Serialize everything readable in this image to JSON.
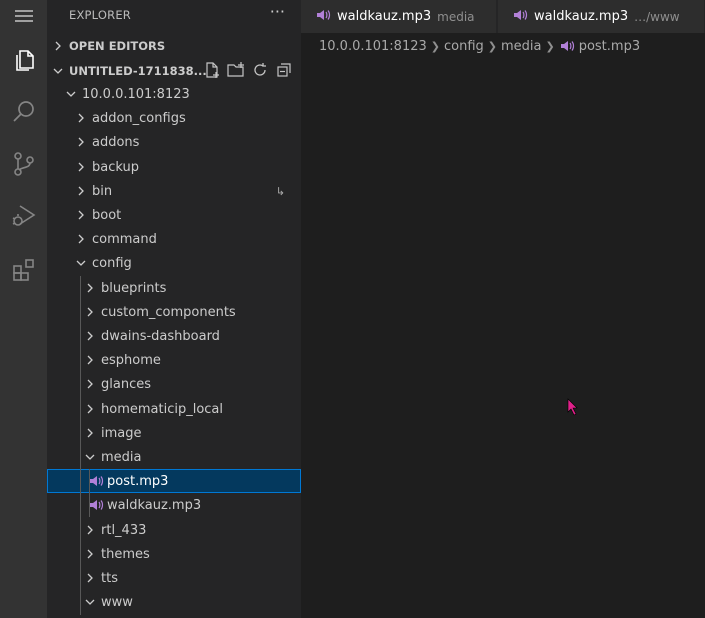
{
  "activity_bar": {
    "items": [
      "menu-icon",
      "files-icon",
      "search-icon",
      "source-control-icon",
      "run-debug-icon",
      "extensions-icon"
    ]
  },
  "sidebar": {
    "title": "EXPLORER",
    "more_label": "···",
    "open_editors": "OPEN EDITORS",
    "workspace": "UNTITLED-1711838...",
    "tree": {
      "root": "10.0.0.101:8123",
      "l1a": [
        "addon_configs",
        "addons",
        "backup",
        "bin",
        "boot",
        "command"
      ],
      "config": "config",
      "config_children_a": [
        "blueprints",
        "custom_components",
        "dwains-dashboard",
        "esphome",
        "glances",
        "homematicip_local",
        "image"
      ],
      "media": "media",
      "media_files": [
        "post.mp3",
        "waldkauz.mp3"
      ],
      "config_children_b": [
        "rtl_433",
        "themes",
        "tts"
      ],
      "www": "www"
    }
  },
  "tabs": [
    {
      "name": "waldkauz.mp3",
      "desc": "media"
    },
    {
      "name": "waldkauz.mp3",
      "desc": "…/www"
    }
  ],
  "breadcrumb": [
    "10.0.0.101:8123",
    "config",
    "media",
    "post.mp3"
  ],
  "colors": {
    "accent": "#0078d4",
    "selection": "#04395e",
    "mp3": "#b180d7"
  }
}
